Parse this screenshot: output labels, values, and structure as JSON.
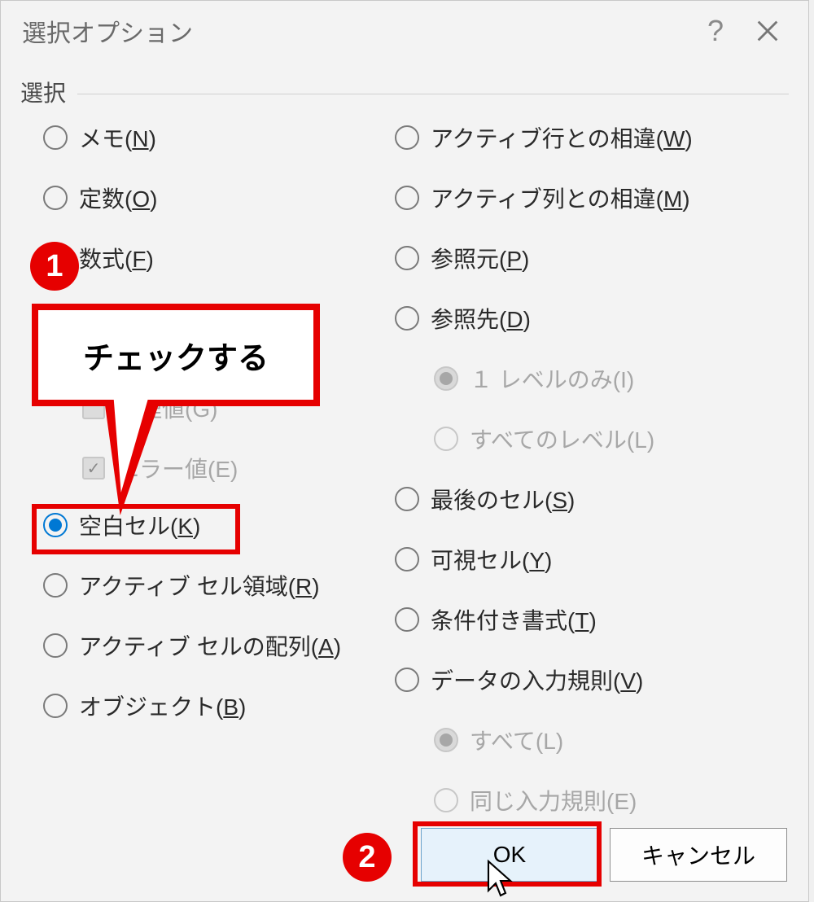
{
  "dialog": {
    "title": "選択オプション",
    "group_label": "選択",
    "left": [
      {
        "label": "メモ(",
        "accel": "N",
        "tail": ")"
      },
      {
        "label": "定数(",
        "accel": "O",
        "tail": ")"
      },
      {
        "label": "数式(",
        "accel": "F",
        "tail": ")"
      }
    ],
    "formula_children": [
      {
        "label": "論理値(G)"
      },
      {
        "label": "エラー値(E)"
      }
    ],
    "blank_label": "空白セル(",
    "blank_accel": "K",
    "blank_tail": ")",
    "left2": [
      {
        "label": "アクティブ セル領域(",
        "accel": "R",
        "tail": ")"
      },
      {
        "label": "アクティブ セルの配列(",
        "accel": "A",
        "tail": ")"
      },
      {
        "label": "オブジェクト(",
        "accel": "B",
        "tail": ")"
      }
    ],
    "right": [
      {
        "label": "アクティブ行との相違(",
        "accel": "W",
        "tail": ")"
      },
      {
        "label": "アクティブ列との相違(",
        "accel": "M",
        "tail": ")"
      },
      {
        "label": "参照元(",
        "accel": "P",
        "tail": ")"
      },
      {
        "label": "参照先(",
        "accel": "D",
        "tail": ")"
      }
    ],
    "ref_children": [
      {
        "label": "１ レベルのみ(I)"
      },
      {
        "label": "すべてのレベル(L)"
      }
    ],
    "right2": [
      {
        "label": "最後のセル(",
        "accel": "S",
        "tail": ")"
      },
      {
        "label": "可視セル(",
        "accel": "Y",
        "tail": ")"
      },
      {
        "label": "条件付き書式(",
        "accel": "T",
        "tail": ")"
      },
      {
        "label": "データの入力規則(",
        "accel": "V",
        "tail": ")"
      }
    ],
    "dv_children": [
      {
        "label": "すべて(L)"
      },
      {
        "label": "同じ入力規則(E)"
      }
    ],
    "buttons": {
      "ok": "OK",
      "cancel": "キャンセル"
    }
  },
  "annotations": {
    "callout_text": "チェックする",
    "badge1": "1",
    "badge2": "2"
  }
}
